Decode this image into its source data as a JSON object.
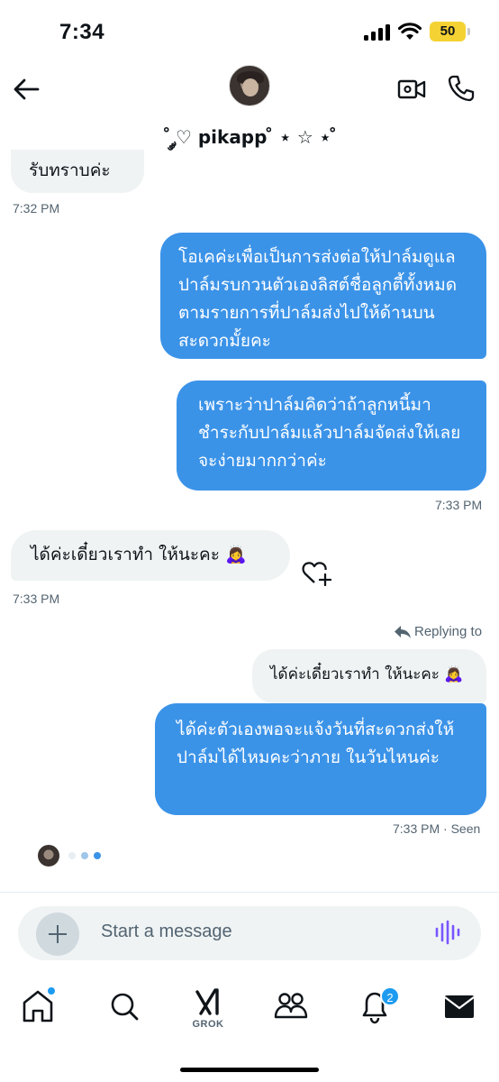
{
  "status_bar": {
    "time": "7:34",
    "battery": "50"
  },
  "header": {
    "contact_name": "˚ ༘♡ pikapp ̊ ⋆ ☆ ⋆ ̊"
  },
  "messages": [
    {
      "direction": "incoming",
      "text": "รับทราบค่ะ",
      "time": "7:32 PM"
    },
    {
      "direction": "outgoing",
      "text": "โอเคค่ะเพื่อเป็นการส่งต่อให้ปาล์มดูแล ปาล์มรบกวนตัวเองลิสต์ชื่อลูกตี้ทั้งหมดตามรายการที่ปาล์มส่งไปให้ด้านบนสะดวกมั้ยคะ"
    },
    {
      "direction": "outgoing",
      "text": "เพราะว่าปาล์มคิดว่าถ้าลูกหนี้มาชำระกับปาล์มแล้วปาล์มจัดส่งให้เลยจะง่ายมากกว่าค่ะ",
      "time": "7:33 PM"
    },
    {
      "direction": "incoming",
      "text": "ได้ค่ะเดี๋ยวเราทำ ให้นะคะ 🙇‍♀️",
      "time": "7:33 PM"
    },
    {
      "direction": "outgoing",
      "reply_label": "Replying to",
      "reply_preview": "ได้ค่ะเดี๋ยวเราทำ ให้นะคะ 🙇‍♀️",
      "text": "ได้ค่ะตัวเองพอจะแจ้งวันที่สะดวกส่งให้ปาล์มได้ไหมคะว่าภาย ในวันไหนค่ะ",
      "time": "7:33 PM",
      "status": " · Seen"
    }
  ],
  "composer": {
    "placeholder": "Start a message"
  },
  "nav": {
    "grok_label": "GROK",
    "notifications_count": "2"
  },
  "colors": {
    "accent": "#1d9bf0",
    "outgoing_bubble": "#3b93e8",
    "incoming_bubble": "#eff3f4"
  }
}
